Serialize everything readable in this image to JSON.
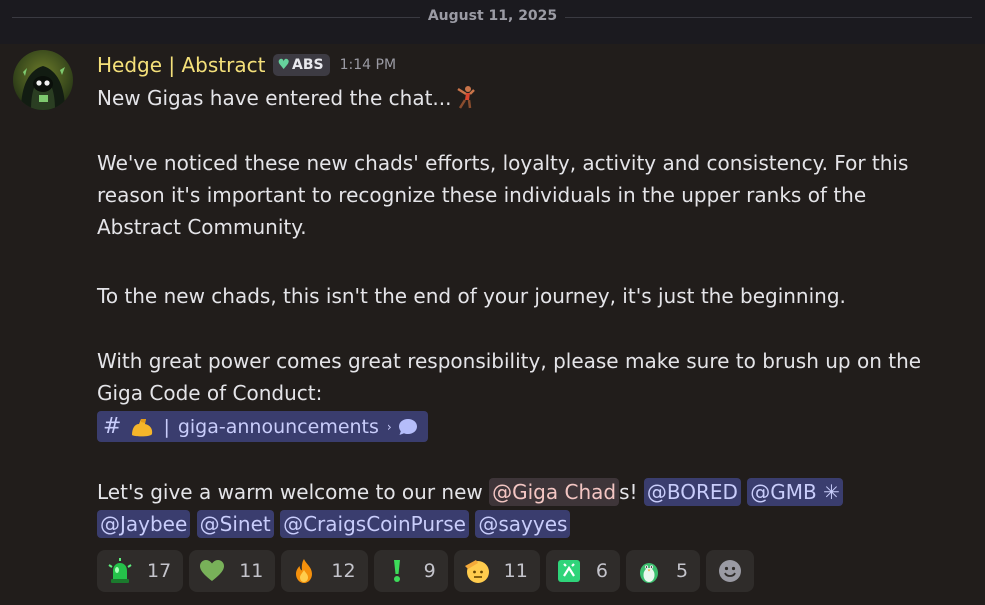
{
  "date_divider": "August 11, 2025",
  "message": {
    "author": "Hedge | Abstract",
    "tag": "ABS",
    "time": "1:14 PM",
    "line1": "New Gigas have entered the chat...",
    "para2": [
      "We've noticed these new chads' efforts, loyalty, activity and consistency. For this",
      "reason it's important to recognize these individuals in the upper ranks of the",
      "Abstract Community."
    ],
    "para3": "To the new chads, this isn't the end of your journey, it's just the beginning.",
    "para4": [
      "With great power comes great responsibility, please make sure to brush up on the",
      "Giga Code of Conduct:"
    ],
    "channel": "giga-announcements",
    "welcome_prefix": "Let's give a warm welcome to our new",
    "role_mention": "@Giga Chad",
    "role_suffix": "s!",
    "mentions_line1": [
      "@BORED",
      "@GMB ✳"
    ],
    "mentions_line2": [
      "@Jaybee",
      "@Sinet",
      "@CraigsCoinPurse",
      "@sayyes"
    ]
  },
  "reactions": [
    {
      "icon": "green-siren-icon",
      "count": "17"
    },
    {
      "icon": "green-heart-icon",
      "count": "11"
    },
    {
      "icon": "fire-icon",
      "count": "12"
    },
    {
      "icon": "green-exclamation-icon",
      "count": "9"
    },
    {
      "icon": "saluting-face-icon",
      "count": "11"
    },
    {
      "icon": "green-square-icon",
      "count": "6"
    },
    {
      "icon": "penguin-icon",
      "count": "5"
    }
  ],
  "colors": {
    "background": "#211d1b",
    "author": "#f4e07a",
    "mention_bg": "#3a3d6e",
    "mention_text": "#c9cdfb"
  }
}
